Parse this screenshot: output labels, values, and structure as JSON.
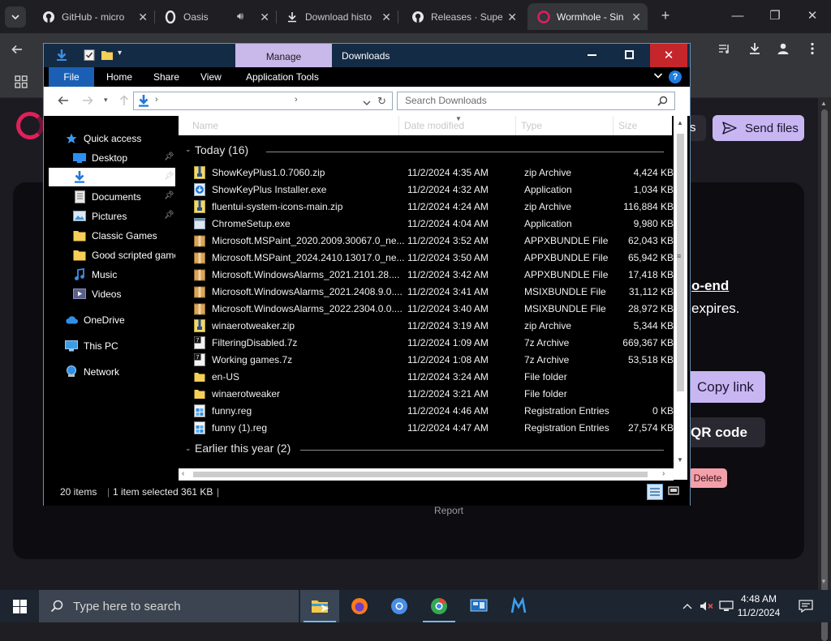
{
  "browser": {
    "tabs": [
      {
        "label": "GitHub - micro",
        "icon": "github-icon"
      },
      {
        "label": "Oasis",
        "icon": "opera-icon"
      },
      {
        "label": "Download histo",
        "icon": "download-icon"
      },
      {
        "label": "Releases · Supe",
        "icon": "github-icon"
      },
      {
        "label": "Wormhole - Sin",
        "icon": "wormhole-icon"
      }
    ],
    "new_tab": "+",
    "close": "✕"
  },
  "wormhole": {
    "s_fragment": "s",
    "send_files": "Send files",
    "e2e_fragment": "o-end",
    "expires_fragment": "expires.",
    "copy_link": "Copy link",
    "qr_code": "QR code",
    "delete": "Delete",
    "report": "Report"
  },
  "explorer": {
    "title": "Downloads",
    "context_tab": "Manage",
    "ribbon_tabs": [
      "File",
      "Home",
      "Share",
      "View",
      "Application Tools"
    ],
    "search_placeholder": "Search Downloads",
    "nav": {
      "quick_access": "Quick access",
      "items": [
        "Desktop",
        "Downloads",
        "Documents",
        "Pictures",
        "Classic Games",
        "Good scripted game",
        "Music",
        "Videos"
      ],
      "onedrive": "OneDrive",
      "this_pc": "This PC",
      "network": "Network"
    },
    "columns": [
      "Name",
      "Date modified",
      "Type",
      "Size"
    ],
    "group_today": "Today (16)",
    "group_earlier": "Earlier this year (2)",
    "files": [
      {
        "name": "ShowKeyPlus1.0.7060.zip",
        "date": "11/2/2024 4:35 AM",
        "type": "zip Archive",
        "size": "4,424 KB",
        "icon": "zip"
      },
      {
        "name": "ShowKeyPlus Installer.exe",
        "date": "11/2/2024 4:32 AM",
        "type": "Application",
        "size": "1,034 KB",
        "icon": "installer"
      },
      {
        "name": "fluentui-system-icons-main.zip",
        "date": "11/2/2024 4:24 AM",
        "type": "zip Archive",
        "size": "116,884 KB",
        "icon": "zip"
      },
      {
        "name": "ChromeSetup.exe",
        "date": "11/2/2024 4:04 AM",
        "type": "Application",
        "size": "9,980 KB",
        "icon": "app"
      },
      {
        "name": "Microsoft.MSPaint_2020.2009.30067.0_ne...",
        "date": "11/2/2024 3:52 AM",
        "type": "APPXBUNDLE File",
        "size": "62,043 KB",
        "icon": "package"
      },
      {
        "name": "Microsoft.MSPaint_2024.2410.13017.0_ne...",
        "date": "11/2/2024 3:50 AM",
        "type": "APPXBUNDLE File",
        "size": "65,942 KB",
        "icon": "package"
      },
      {
        "name": "Microsoft.WindowsAlarms_2021.2101.28....",
        "date": "11/2/2024 3:42 AM",
        "type": "APPXBUNDLE File",
        "size": "17,418 KB",
        "icon": "package"
      },
      {
        "name": "Microsoft.WindowsAlarms_2021.2408.9.0....",
        "date": "11/2/2024 3:41 AM",
        "type": "MSIXBUNDLE File",
        "size": "31,112 KB",
        "icon": "package"
      },
      {
        "name": "Microsoft.WindowsAlarms_2022.2304.0.0....",
        "date": "11/2/2024 3:40 AM",
        "type": "MSIXBUNDLE File",
        "size": "28,972 KB",
        "icon": "package"
      },
      {
        "name": "winaerotweaker.zip",
        "date": "11/2/2024 3:19 AM",
        "type": "zip Archive",
        "size": "5,344 KB",
        "icon": "zip"
      },
      {
        "name": "FilteringDisabled.7z",
        "date": "11/2/2024 1:09 AM",
        "type": "7z Archive",
        "size": "669,367 KB",
        "icon": "sevenz"
      },
      {
        "name": "Working games.7z",
        "date": "11/2/2024 1:08 AM",
        "type": "7z Archive",
        "size": "53,518 KB",
        "icon": "sevenz"
      },
      {
        "name": "en-US",
        "date": "11/2/2024 3:24 AM",
        "type": "File folder",
        "size": "",
        "icon": "folder"
      },
      {
        "name": "winaerotweaker",
        "date": "11/2/2024 3:21 AM",
        "type": "File folder",
        "size": "",
        "icon": "folder"
      },
      {
        "name": "funny.reg",
        "date": "11/2/2024 4:46 AM",
        "type": "Registration Entries",
        "size": "0 KB",
        "icon": "reg"
      },
      {
        "name": "funny (1).reg",
        "date": "11/2/2024 4:47 AM",
        "type": "Registration Entries",
        "size": "27,574 KB",
        "icon": "reg"
      }
    ],
    "status": {
      "count": "20 items",
      "selection": "1 item selected  361 KB"
    }
  },
  "taskbar": {
    "search_placeholder": "Type here to search",
    "time": "4:48 AM",
    "date": "11/2/2024"
  },
  "colors": {
    "accent_lilac": "#c8b6f2",
    "explorer_title": "#142b45",
    "close_red": "#c4262b",
    "file_tab_blue": "#1a5fb4"
  }
}
